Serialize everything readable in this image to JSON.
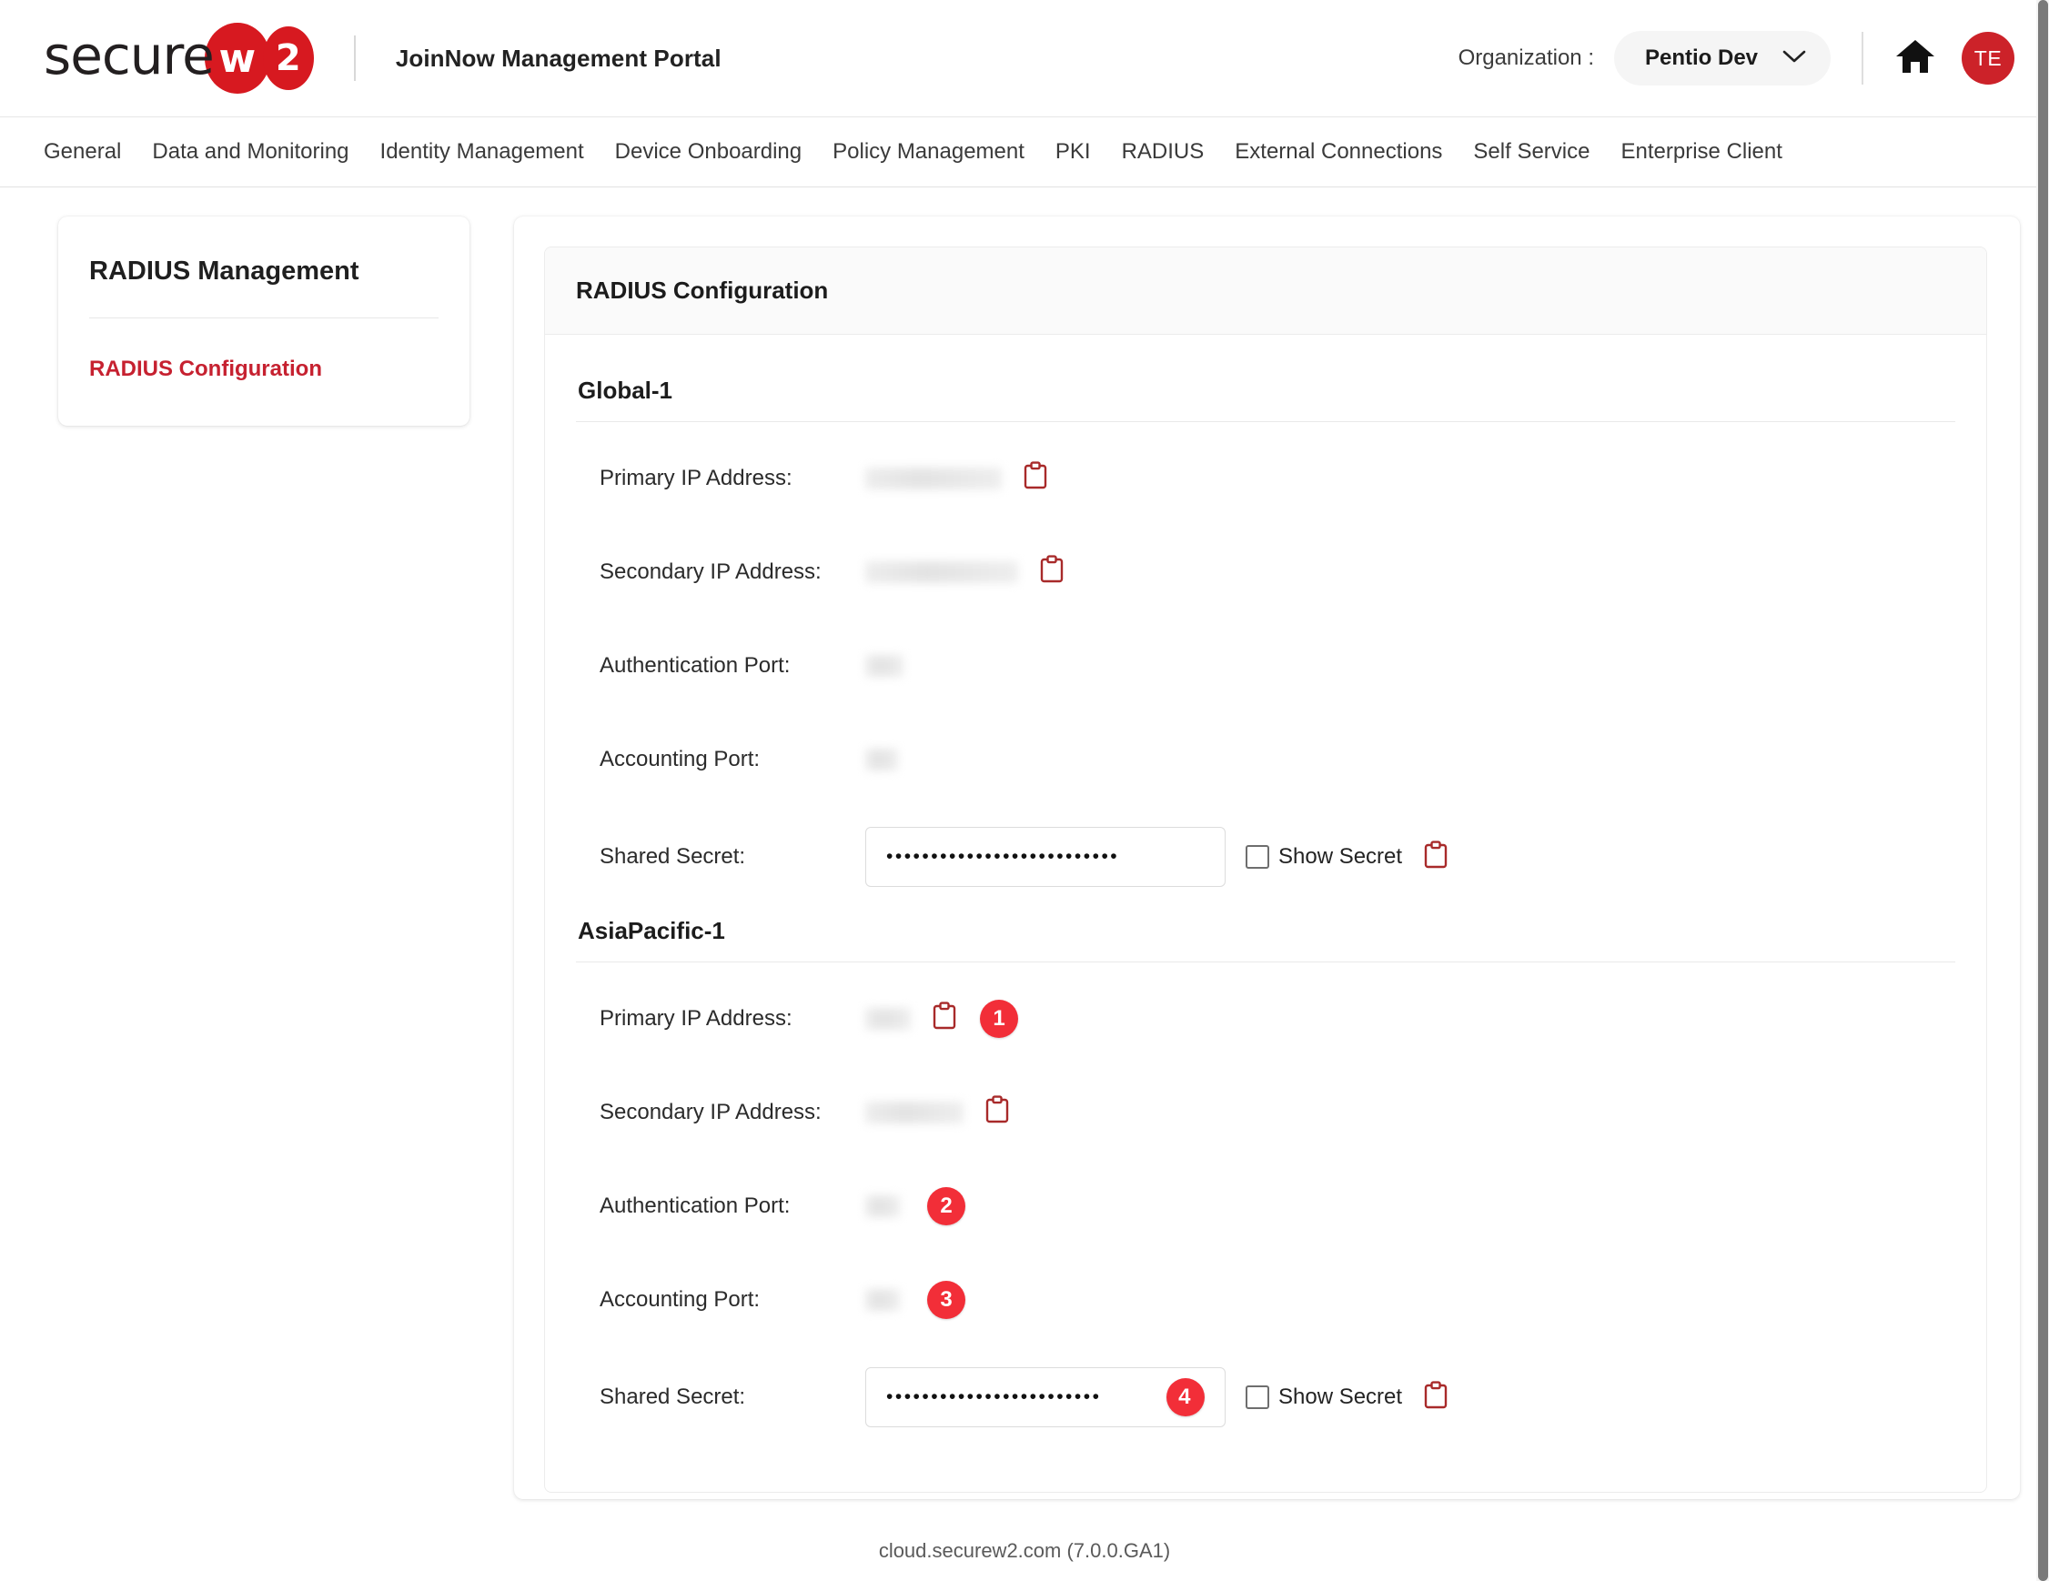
{
  "header": {
    "logo_text": "secure",
    "logo_badge_1": "w",
    "logo_badge_2": "2",
    "portal_title": "JoinNow Management Portal",
    "org_label": "Organization :",
    "org_value": "Pentio Dev",
    "avatar_initials": "TE",
    "icons": {
      "chevron": "chevron-down-icon",
      "home": "home-icon"
    },
    "brand_red": "#d71920",
    "avatar_red": "#cc2229"
  },
  "nav": {
    "items": [
      {
        "label": "General"
      },
      {
        "label": "Data and Monitoring"
      },
      {
        "label": "Identity Management"
      },
      {
        "label": "Device Onboarding"
      },
      {
        "label": "Policy Management"
      },
      {
        "label": "PKI"
      },
      {
        "label": "RADIUS"
      },
      {
        "label": "External Connections"
      },
      {
        "label": "Self Service"
      },
      {
        "label": "Enterprise Client"
      }
    ]
  },
  "sidebar": {
    "title": "RADIUS Management",
    "link": "RADIUS Configuration",
    "link_color": "#c62130"
  },
  "main": {
    "card_title": "RADIUS Configuration",
    "sections": [
      {
        "name": "Global-1",
        "rows": [
          {
            "label": "Primary IP Address:",
            "value": "",
            "redacted": true,
            "copy": true,
            "badge": ""
          },
          {
            "label": "Secondary IP Address:",
            "value": "",
            "redacted": true,
            "copy": true,
            "badge": ""
          },
          {
            "label": "Authentication Port:",
            "value": "",
            "redacted": true,
            "copy": false,
            "badge": ""
          },
          {
            "label": "Accounting Port:",
            "value": "",
            "redacted": true,
            "copy": false,
            "badge": ""
          }
        ],
        "secret": {
          "label": "Shared Secret:",
          "value": "••••••••••••••••••••••••••",
          "show_secret_label": "Show Secret",
          "show_secret_checked": false,
          "copy": true,
          "badge": ""
        }
      },
      {
        "name": "AsiaPacific-1",
        "rows": [
          {
            "label": "Primary IP Address:",
            "value": "",
            "redacted": true,
            "copy": true,
            "badge": "1"
          },
          {
            "label": "Secondary IP Address:",
            "value": "",
            "redacted": true,
            "copy": true,
            "badge": ""
          },
          {
            "label": "Authentication Port:",
            "value": "",
            "redacted": true,
            "copy": false,
            "badge": "2"
          },
          {
            "label": "Accounting Port:",
            "value": "",
            "redacted": true,
            "copy": false,
            "badge": "3"
          }
        ],
        "secret": {
          "label": "Shared Secret:",
          "value": "••••••••••••••••••••••••",
          "show_secret_label": "Show Secret",
          "show_secret_checked": false,
          "copy": true,
          "badge": "4"
        }
      }
    ],
    "badge_color": "#f22e38",
    "copy_icon_color": "#a82a2a"
  },
  "footer": {
    "text": "cloud.securew2.com (7.0.0.GA1)"
  }
}
